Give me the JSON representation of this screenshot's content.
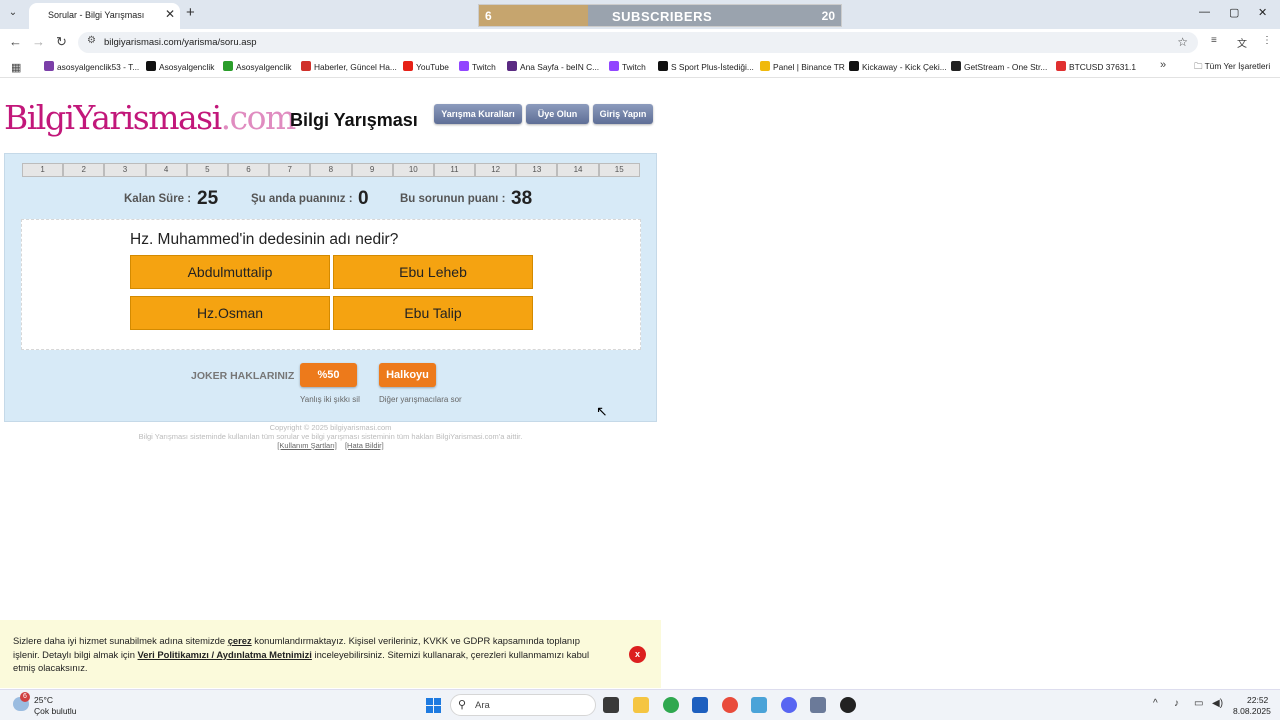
{
  "browser": {
    "tab_title": "Sorular - Bilgi Yarışması",
    "url": "bilgiyarismasi.com/yarisma/soru.asp",
    "subscriber_banner": {
      "current": "6",
      "label": "SUBSCRIBERS",
      "goal": "20",
      "progress": 0.3
    },
    "window": {
      "minimize": "—",
      "restore": "▢",
      "close": "✕"
    },
    "bookmarks": [
      {
        "label": "asosyalgenclik53 - T...",
        "color": "#7b3fa8"
      },
      {
        "label": "Asosyalgenclik",
        "color": "#111111"
      },
      {
        "label": "Asosyalgenclik",
        "color": "#2a9d2a"
      },
      {
        "label": "Haberler, Güncel Ha...",
        "color": "#d0302a"
      },
      {
        "label": "YouTube",
        "color": "#e62117"
      },
      {
        "label": "Twitch",
        "color": "#9146ff"
      },
      {
        "label": "Ana Sayfa - beIN C...",
        "color": "#5a2a82"
      },
      {
        "label": "Twitch",
        "color": "#9146ff"
      },
      {
        "label": "S Sport Plus-İstediği...",
        "color": "#111111"
      },
      {
        "label": "Panel | Binance TR",
        "color": "#f0b90b"
      },
      {
        "label": "Kickaway - Kick Çeki...",
        "color": "#111111"
      },
      {
        "label": "GetStream - One Str...",
        "color": "#222222"
      },
      {
        "label": "BTCUSD 37631.1",
        "color": "#e03030"
      }
    ],
    "all_bookmarks": "Tüm Yer İşaretleri"
  },
  "site": {
    "logo_main": "BilgiYarismasi",
    "logo_domain": ".com",
    "title": "Bilgi Yarışması",
    "nav": [
      "Yarışma Kuralları",
      "Üye Olun",
      "Giriş Yapın"
    ]
  },
  "game": {
    "question_numbers": [
      "1",
      "2",
      "3",
      "4",
      "5",
      "6",
      "7",
      "8",
      "9",
      "10",
      "11",
      "12",
      "13",
      "14",
      "15"
    ],
    "remaining_label": "Kalan Süre :",
    "remaining_value": "25",
    "score_label": "Şu anda puanınız :",
    "score_value": "0",
    "question_points_label": "Bu sorunun puanı :",
    "question_points_value": "38",
    "question": "Hz. Muhammed'in dedesinin adı nedir?",
    "answers": [
      "Abdulmuttalip",
      "Ebu Leheb",
      "Hz.Osman",
      "Ebu Talip"
    ],
    "jokers_label": "JOKER HAKLARINIZ",
    "joker1": {
      "label": "%50",
      "desc": "Yanlış iki şıkkı sil"
    },
    "joker2": {
      "label": "Halkoyu",
      "desc": "Diğer yarışmacılara sor"
    }
  },
  "footer": {
    "copyright": "Copyright © 2025 bilgiyarismasi.com",
    "rights": "Bilgi Yarışması sisteminde kullanılan tüm sorular ve bilgi yarışması sisteminin tüm hakları BilgiYarismasi.com'a aittir.",
    "links": [
      "[Kullanım Şartları]",
      "[Hata Bildir]"
    ]
  },
  "cookie": {
    "text_1": "Sizlere daha iyi hizmet sunabilmek adına sitemizde ",
    "link_1": "çerez",
    "text_2": " konumlandırmaktayız. Kişisel verileriniz, KVKK ve GDPR kapsamında toplanıp işlenir. Detaylı bilgi almak için ",
    "link_2": "Veri Politikamızı / Aydınlatma Metnimizi",
    "text_3": " inceleyebilirsiniz. Sitemizi kullanarak, çerezleri kullanmamızı kabul etmiş olacaksınız.",
    "close": "x"
  },
  "taskbar": {
    "weather_badge": "6",
    "temperature": "25°C",
    "weather_desc": "Çok bulutlu",
    "search_placeholder": "Ara",
    "time": "22:52",
    "date": "8.08.2025"
  }
}
